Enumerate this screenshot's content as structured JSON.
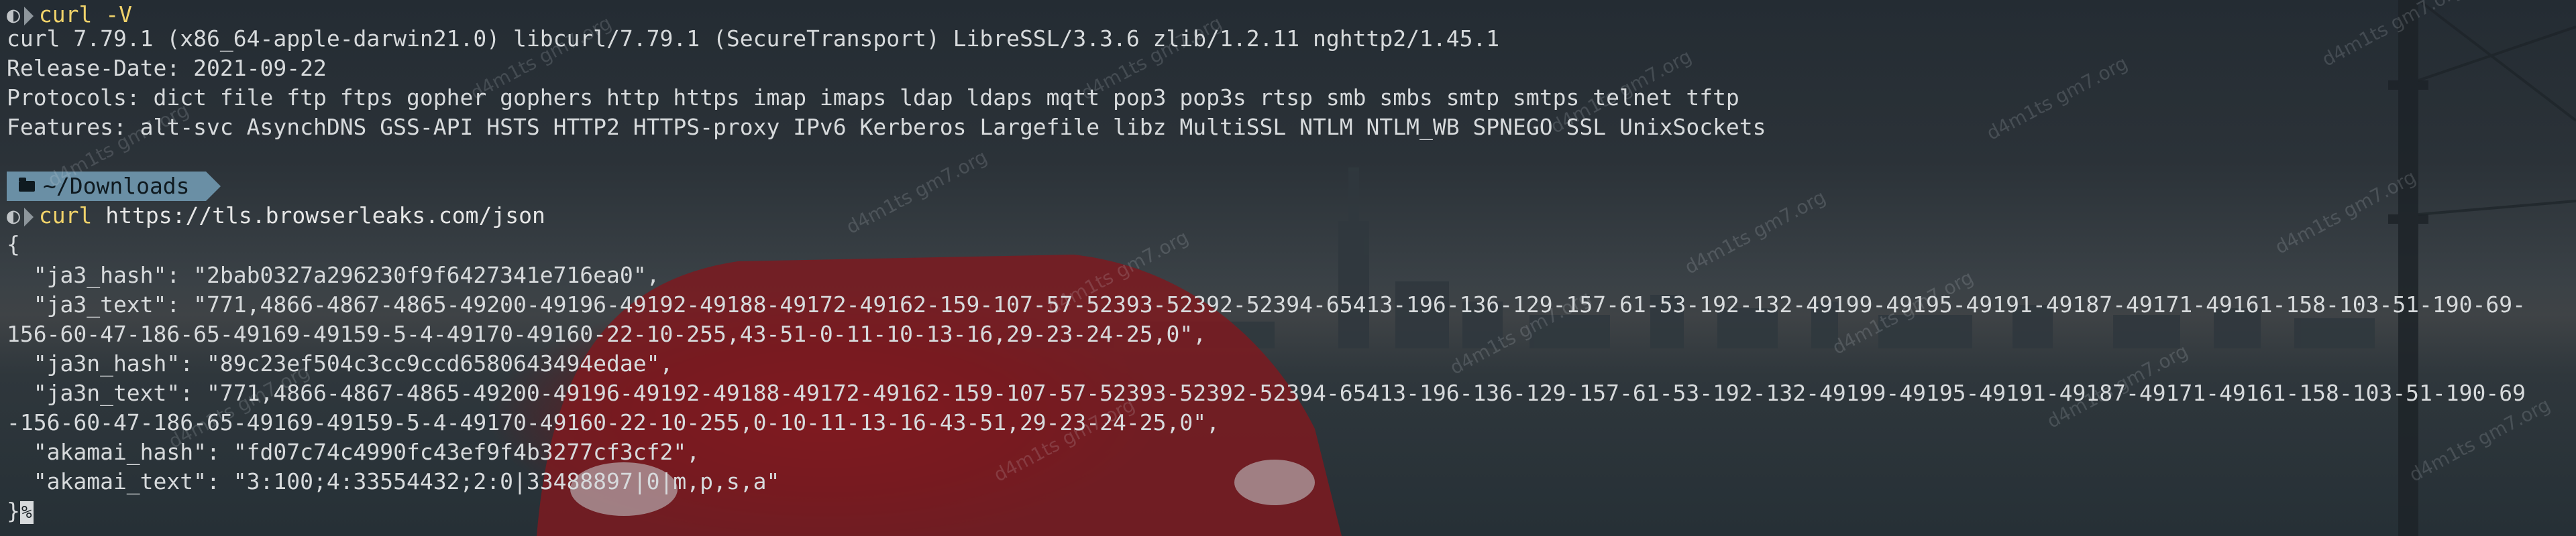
{
  "session1": {
    "command": "curl -V",
    "output": [
      "curl 7.79.1 (x86_64-apple-darwin21.0) libcurl/7.79.1 (SecureTransport) LibreSSL/3.3.6 zlib/1.2.11 nghttp2/1.45.1",
      "Release-Date: 2021-09-22",
      "Protocols: dict file ftp ftps gopher gophers http https imap imaps ldap ldaps mqtt pop3 pop3s rtsp smb smbs smtp smtps telnet tftp",
      "Features: alt-svc AsynchDNS GSS-API HSTS HTTP2 HTTPS-proxy IPv6 Kerberos Largefile libz MultiSSL NTLM NTLM_WB SPNEGO SSL UnixSockets"
    ]
  },
  "cwd": "~/Downloads",
  "session2": {
    "command_name": "curl",
    "command_arg": "https://tls.browserleaks.com/json",
    "output": [
      "{",
      "  \"ja3_hash\": \"2bab0327a296230f9f6427341e716ea0\",",
      "  \"ja3_text\": \"771,4866-4867-4865-49200-49196-49192-49188-49172-49162-159-107-57-52393-52392-52394-65413-196-136-129-157-61-53-192-132-49199-49195-49191-49187-49171-49161-158-103-51-190-69-",
      "156-60-47-186-65-49169-49159-5-4-49170-49160-22-10-255,43-51-0-11-10-13-16,29-23-24-25,0\",",
      "  \"ja3n_hash\": \"89c23ef504c3cc9ccd6580643494edae\",",
      "  \"ja3n_text\": \"771,4866-4867-4865-49200-49196-49192-49188-49172-49162-159-107-57-52393-52392-52394-65413-196-136-129-157-61-53-192-132-49199-49195-49191-49187-49171-49161-158-103-51-190-69",
      "-156-60-47-186-65-49169-49159-5-4-49170-49160-22-10-255,0-10-11-13-16-43-51,29-23-24-25,0\",",
      "  \"akamai_hash\": \"fd07c74c4990fc43ef9f4b3277cf3cf2\",",
      "  \"akamai_text\": \"3:100;4:33554432;2:0|33488897|0|m,p,s,a\"",
      "}"
    ],
    "cursor_char": "%"
  },
  "watermark_text": "d4m1ts gm7.org"
}
